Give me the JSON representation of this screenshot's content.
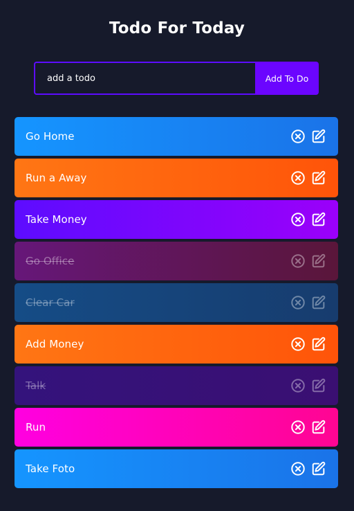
{
  "header": {
    "title": "Todo For Today"
  },
  "form": {
    "placeholder": "add a todo",
    "add_button_label": "Add To Do",
    "accent_color": "#5d0cff"
  },
  "todos": [
    {
      "text": "Go Home",
      "completed": false,
      "gradient": [
        "#1595ff",
        "#1a73e8"
      ]
    },
    {
      "text": "Run a Away",
      "completed": false,
      "gradient": [
        "#ff7614",
        "#ff5409"
      ]
    },
    {
      "text": "Take Money",
      "completed": false,
      "gradient": [
        "#5d0cff",
        "#9b00fa"
      ]
    },
    {
      "text": "Go Office",
      "completed": true,
      "gradient": [
        "#661779",
        "#5a163a"
      ]
    },
    {
      "text": "Clear Car",
      "completed": true,
      "gradient": [
        "#154c86",
        "#173c6e"
      ]
    },
    {
      "text": "Add Money",
      "completed": false,
      "gradient": [
        "#ff7614",
        "#ff5409"
      ]
    },
    {
      "text": "Talk",
      "completed": true,
      "gradient": [
        "#34137c",
        "#3a0f72"
      ]
    },
    {
      "text": "Run",
      "completed": false,
      "gradient": [
        "#ff00e1",
        "#ff0592"
      ]
    },
    {
      "text": "Take Foto",
      "completed": false,
      "gradient": [
        "#1595ff",
        "#1a73e8"
      ]
    }
  ],
  "icons": {
    "delete": "close-circle-icon",
    "edit": "edit-icon"
  },
  "colors": {
    "background": "#161a2b",
    "text": "#ffffff"
  }
}
